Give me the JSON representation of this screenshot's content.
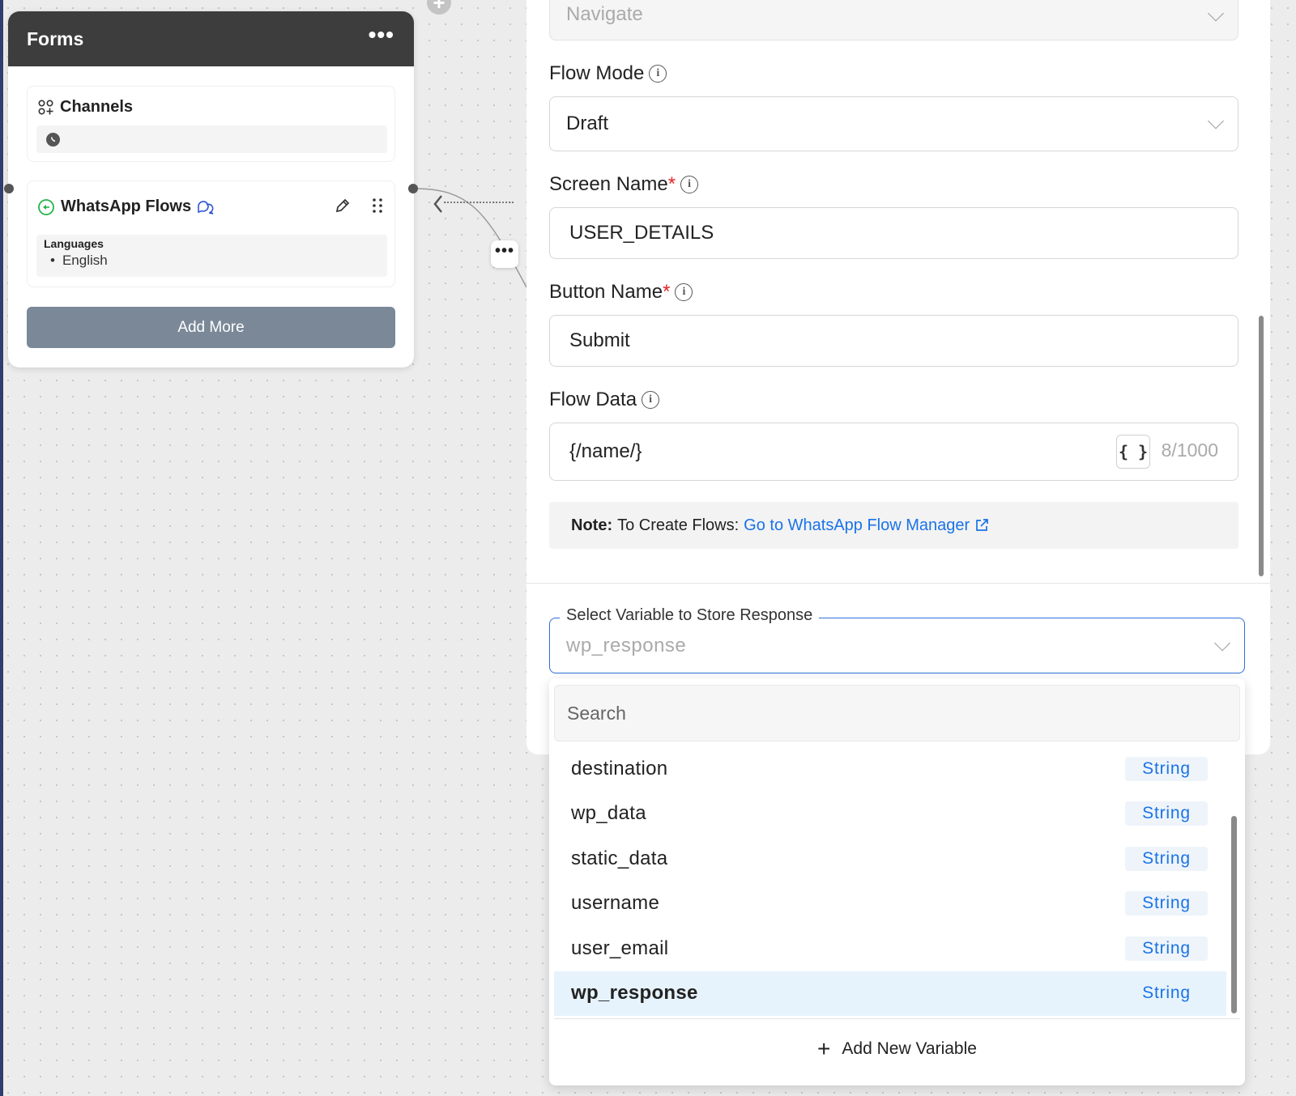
{
  "forms_node": {
    "title": "Forms",
    "menu_label": "•••",
    "channels_label": "Channels",
    "whatsapp_flows_label": "WhatsApp Flows",
    "languages_title": "Languages",
    "languages": [
      "English"
    ],
    "add_more_label": "Add More"
  },
  "edge_menu_label": "•••",
  "panel": {
    "navigate_value": "Navigate",
    "flow_mode": {
      "label": "Flow Mode",
      "value": "Draft"
    },
    "screen_name": {
      "label": "Screen Name",
      "required_mark": "*",
      "value": "USER_DETAILS"
    },
    "button_name": {
      "label": "Button Name",
      "required_mark": "*",
      "value": "Submit"
    },
    "flow_data": {
      "label": "Flow Data",
      "value": "{/name/}",
      "brace_label": "{ }",
      "counter": "8/1000"
    },
    "note": {
      "prefix": "Note:",
      "text": "To Create Flows:",
      "link": "Go to WhatsApp Flow Manager"
    }
  },
  "variable_select": {
    "legend": "Select Variable to Store Response",
    "value": "wp_response",
    "search_placeholder": "Search",
    "items": [
      {
        "name": "destination",
        "type": "String"
      },
      {
        "name": "wp_data",
        "type": "String"
      },
      {
        "name": "static_data",
        "type": "String"
      },
      {
        "name": "username",
        "type": "String"
      },
      {
        "name": "user_email",
        "type": "String"
      },
      {
        "name": "wp_response",
        "type": "String",
        "selected": true
      }
    ],
    "add_new_label": "Add New Variable"
  },
  "colors": {
    "accent": "#1a73e8",
    "header_dark": "#3d3d3d",
    "button_gray": "#7a8898",
    "required": "#e02424",
    "selected_bg": "#e7f3fc"
  }
}
